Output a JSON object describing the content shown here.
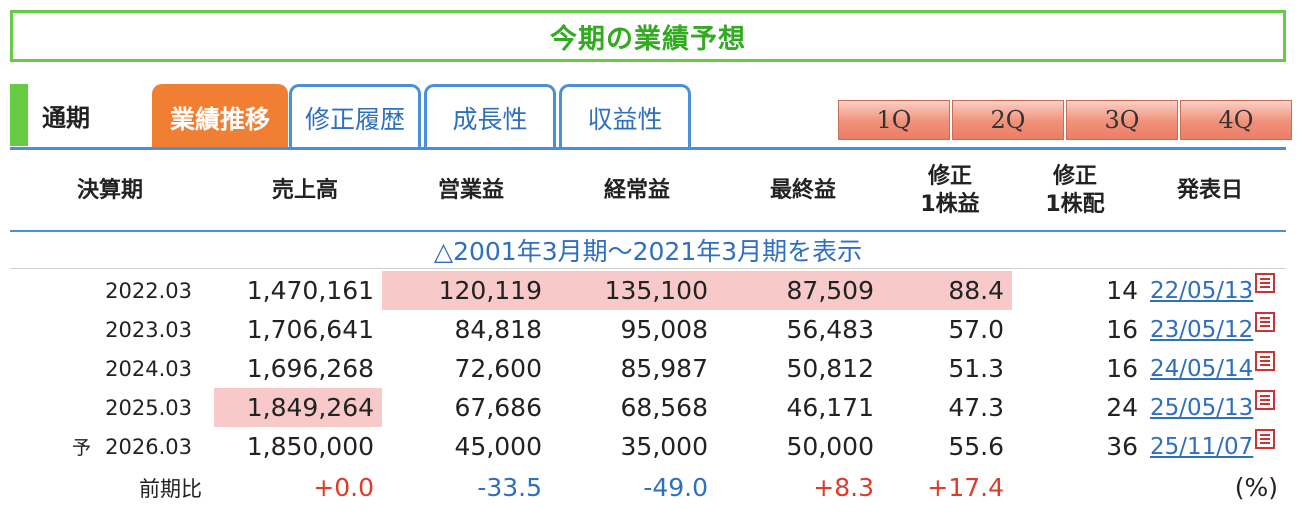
{
  "title": "今期の業績予想",
  "tabs": {
    "static": "通期",
    "items": [
      {
        "label": "業績推移",
        "active": true
      },
      {
        "label": "修正履歴",
        "active": false
      },
      {
        "label": "成長性",
        "active": false
      },
      {
        "label": "収益性",
        "active": false
      }
    ]
  },
  "quarter_buttons": [
    "1Q",
    "2Q",
    "3Q",
    "4Q"
  ],
  "headers": {
    "period": "決算期",
    "sales": "売上高",
    "operating": "営業益",
    "ordinary": "経常益",
    "net": "最終益",
    "eps_line1": "修正",
    "eps_line2": "1株益",
    "dps_line1": "修正",
    "dps_line2": "1株配",
    "date": "発表日"
  },
  "expand_link": "△2001年3月期〜2021年3月期を表示",
  "rows": [
    {
      "prefix": "",
      "period": "2022.03",
      "sales": "1,470,161",
      "operating": "120,119",
      "ordinary": "135,100",
      "net": "87,509",
      "eps": "88.4",
      "dps": "14",
      "date": "22/05/13"
    },
    {
      "prefix": "",
      "period": "2023.03",
      "sales": "1,706,641",
      "operating": "84,818",
      "ordinary": "95,008",
      "net": "56,483",
      "eps": "57.0",
      "dps": "16",
      "date": "23/05/12"
    },
    {
      "prefix": "",
      "period": "2024.03",
      "sales": "1,696,268",
      "operating": "72,600",
      "ordinary": "85,987",
      "net": "50,812",
      "eps": "51.3",
      "dps": "16",
      "date": "24/05/14"
    },
    {
      "prefix": "",
      "period": "2025.03",
      "sales": "1,849,264",
      "operating": "67,686",
      "ordinary": "68,568",
      "net": "46,171",
      "eps": "47.3",
      "dps": "24",
      "date": "25/05/13"
    },
    {
      "prefix": "予",
      "period": "2026.03",
      "sales": "1,850,000",
      "operating": "45,000",
      "ordinary": "35,000",
      "net": "50,000",
      "eps": "55.6",
      "dps": "36",
      "date": "25/11/07"
    }
  ],
  "yoy": {
    "label": "前期比",
    "sales": "+0.0",
    "operating": "-33.5",
    "ordinary": "-49.0",
    "net": "+8.3",
    "eps": "+17.4",
    "unit": "(%)"
  },
  "colors": {
    "green": "#66cc44",
    "tab_blue": "#4a90d9",
    "active_tab": "#f07f33",
    "highlight": "#f7c9c9",
    "positive": "#e03a2a",
    "negative": "#2f6fc0"
  }
}
